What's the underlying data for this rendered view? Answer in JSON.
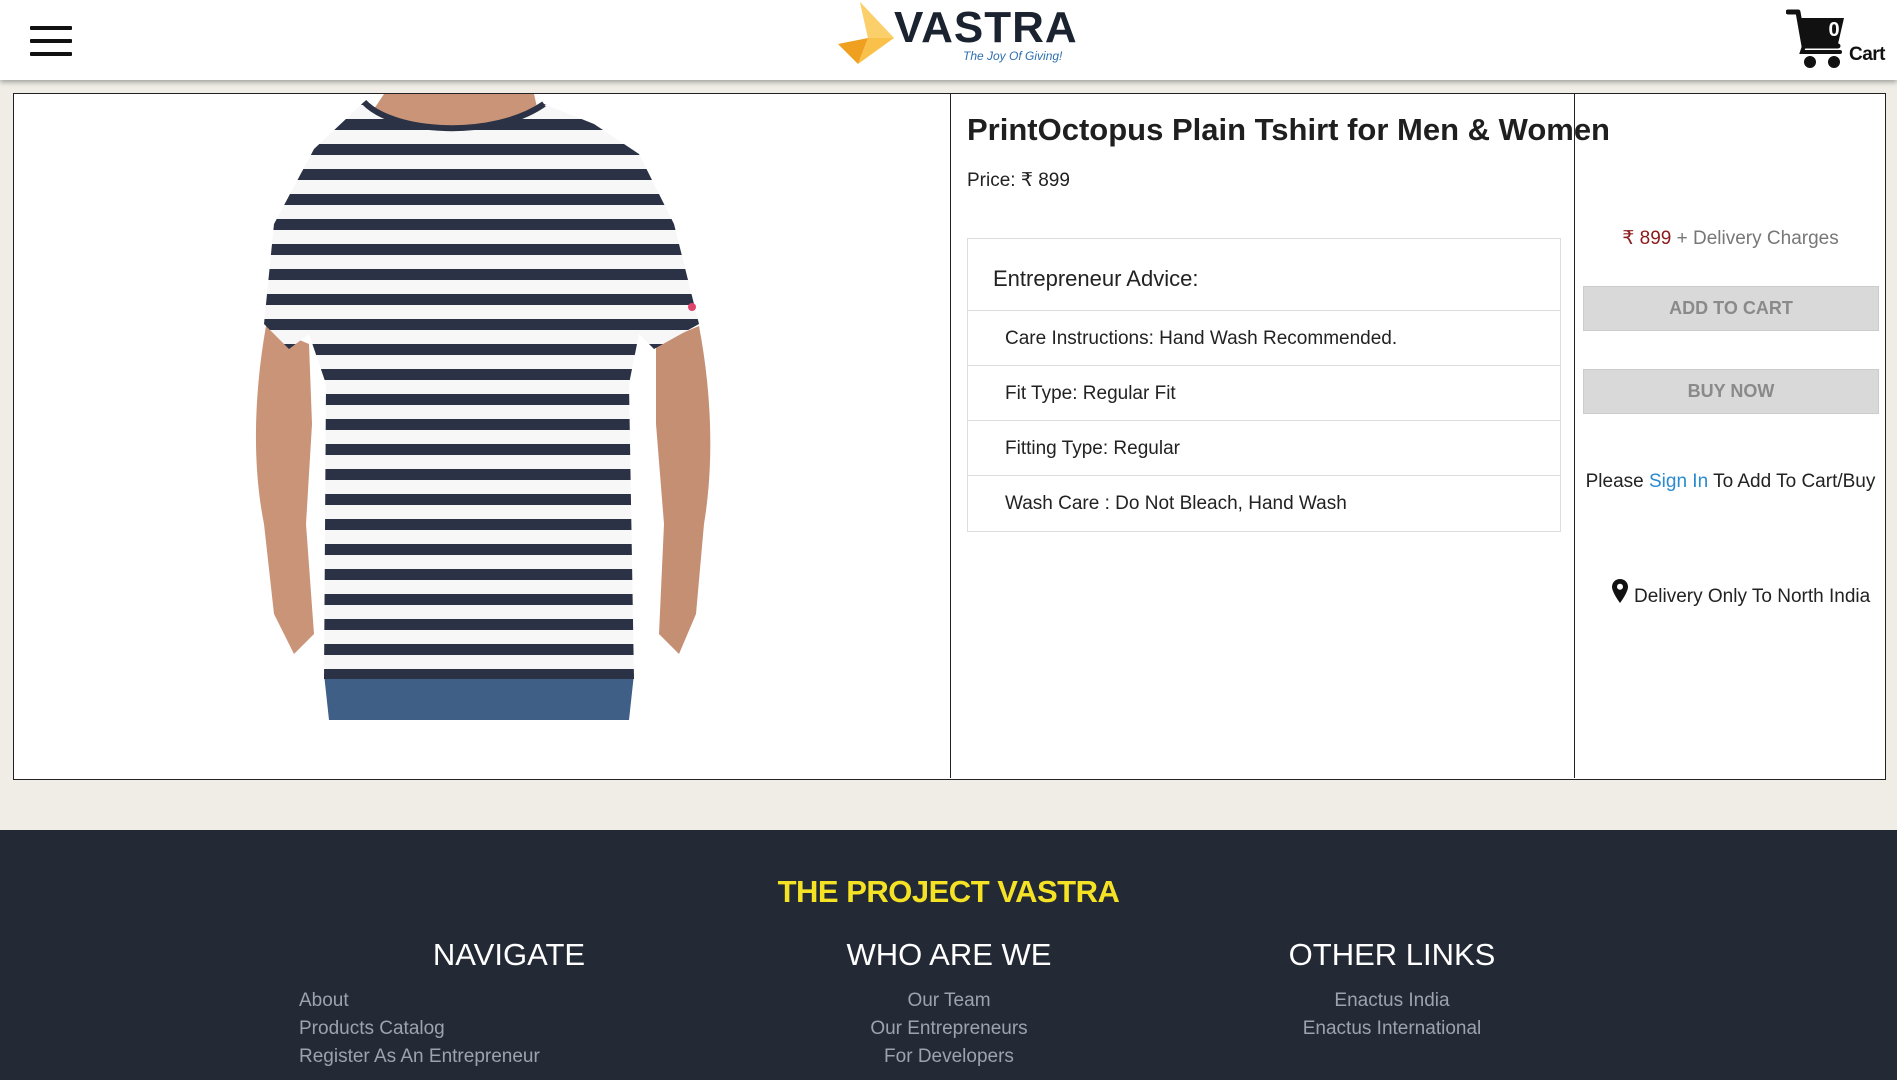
{
  "header": {
    "menu_icon": "hamburger-menu-icon",
    "logo": {
      "name": "VASTRA",
      "tagline": "The Joy Of Giving!",
      "colors": {
        "arrow_light": "#f9c04a",
        "arrow_dark": "#f0a020",
        "text": "#1b2330",
        "tagline": "#2e6fb0"
      }
    },
    "cart": {
      "icon": "shopping-cart-icon",
      "count": "0",
      "label": "Cart"
    }
  },
  "product": {
    "image_alt": "Striped navy and white crew-neck t-shirt worn by model",
    "title": "PrintOctopus Plain Tshirt for Men & Women",
    "price_label": "Price: ₹ 899",
    "advice": {
      "heading": "Entrepreneur Advice:",
      "items": [
        "Care Instructions: Hand Wash Recommended.",
        "Fit Type: Regular Fit",
        "Fitting Type: Regular",
        "Wash Care : Do Not Bleach, Hand Wash"
      ]
    }
  },
  "buy_box": {
    "price_amount": "₹ 899",
    "price_suffix": " + Delivery Charges",
    "add_to_cart_label": "ADD TO CART",
    "buy_now_label": "BUY NOW",
    "signin_prefix": "Please ",
    "signin_link": "Sign In",
    "signin_suffix": " To Add To Cart/Buy",
    "delivery_icon": "location-pin-icon",
    "delivery_text": "Delivery Only To North India"
  },
  "footer": {
    "title": "THE PROJECT VASTRA",
    "columns": [
      {
        "heading": "NAVIGATE",
        "links": [
          "About",
          "Products Catalog",
          "Register As An Entrepreneur"
        ]
      },
      {
        "heading": "WHO ARE WE",
        "links": [
          "Our Team",
          "Our Entrepreneurs",
          "For Developers"
        ]
      },
      {
        "heading": "OTHER LINKS",
        "links": [
          "Enactus India",
          "Enactus International"
        ]
      }
    ]
  },
  "colors": {
    "page_bg": "#efede6",
    "footer_bg": "#232a36",
    "footer_title": "#f5e224",
    "link_blue": "#2a8bd0",
    "price_red": "#8b1a1a",
    "button_bg": "#d9d9d9"
  }
}
